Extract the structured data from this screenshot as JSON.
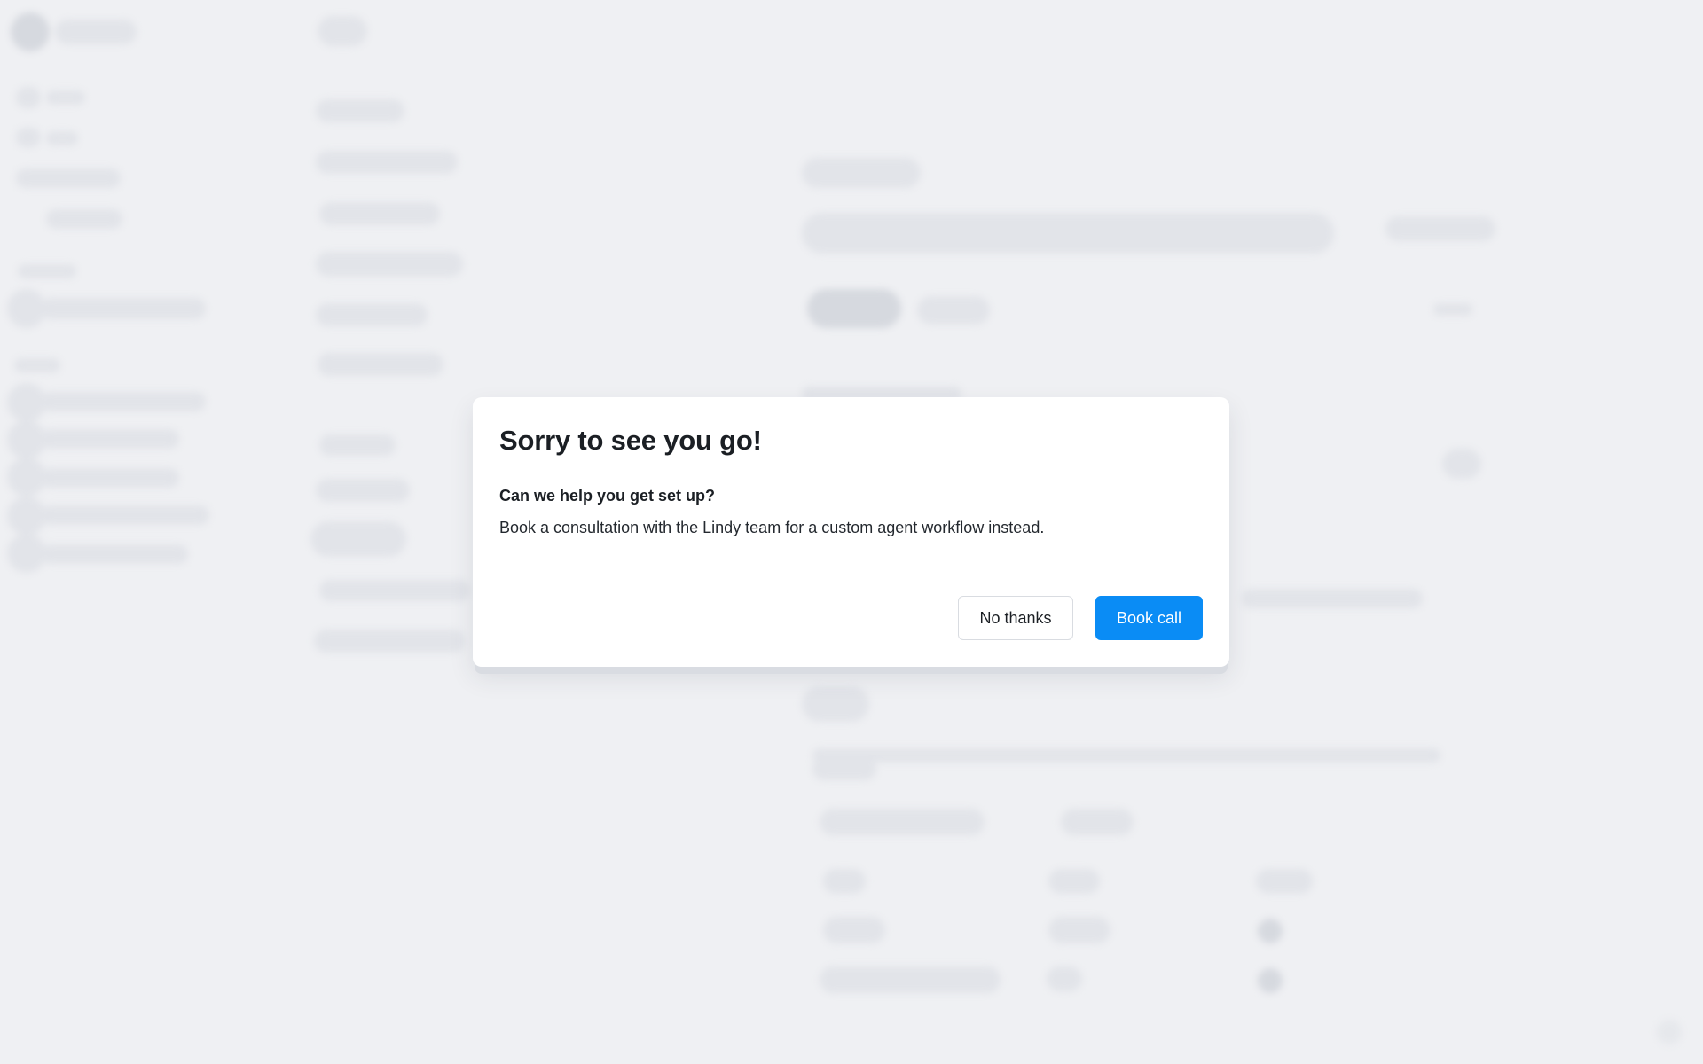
{
  "modal": {
    "title": "Sorry to see you go!",
    "subtitle": "Can we help you get set up?",
    "body": "Book a consultation with the Lindy team for a custom agent workflow instead.",
    "secondary_label": "No thanks",
    "primary_label": "Book call"
  },
  "colors": {
    "primary": "#0a8cf5",
    "background": "#eff0f3",
    "surface": "#ffffff"
  }
}
